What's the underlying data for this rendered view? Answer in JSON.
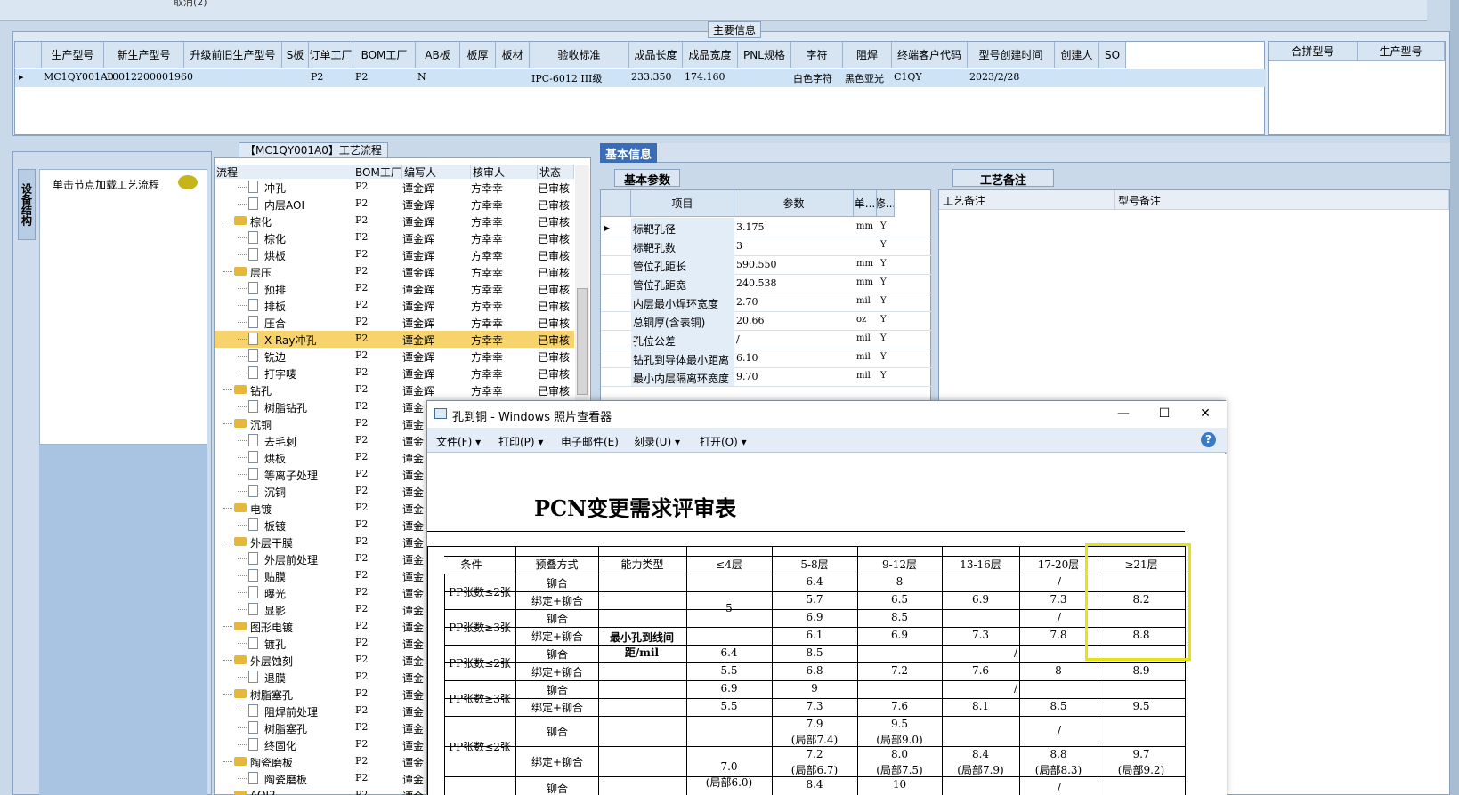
{
  "top": {
    "cut_text": "取消(2)"
  },
  "main_info": {
    "title": "主要信息",
    "headers": [
      "生产型号",
      "新生产型号",
      "升级前旧生产型号",
      "S板",
      "订单工厂",
      "BOM工厂",
      "AB板",
      "板厚",
      "板材",
      "验收标准",
      "成品长度",
      "成品宽度",
      "PNL规格",
      "字符",
      "阻焊",
      "终端客户代码",
      "型号创建时间",
      "创建人",
      "SO"
    ],
    "row": [
      "MC1QY001A0",
      "10012200001960",
      "",
      "",
      "P2",
      "P2",
      "N",
      "",
      "",
      "IPC-6012 III级",
      "233.350",
      "174.160",
      "",
      "白色字符",
      "黑色亚光",
      "C1QY",
      "2023/2/28",
      "",
      ""
    ],
    "side_headers": [
      "合拼型号",
      "生产型号"
    ]
  },
  "left": {
    "vertical_tab": "设备结构",
    "hint": "单击节点加载工艺流程"
  },
  "flow": {
    "title": "【MC1QY001A0】工艺流程",
    "headers": [
      "流程",
      "BOM工厂",
      "编写人",
      "核审人",
      "状态"
    ],
    "rows": [
      {
        "name": "冲孔",
        "level": 2,
        "bom": "P2",
        "writer": "谭金辉",
        "reviewer": "方幸幸",
        "status": "已审核"
      },
      {
        "name": "内层AOI",
        "level": 2,
        "bom": "P2",
        "writer": "谭金辉",
        "reviewer": "方幸幸",
        "status": "已审核"
      },
      {
        "name": "棕化",
        "level": 1,
        "bom": "P2",
        "writer": "谭金辉",
        "reviewer": "方幸幸",
        "status": "已审核"
      },
      {
        "name": "棕化",
        "level": 2,
        "bom": "P2",
        "writer": "谭金辉",
        "reviewer": "方幸幸",
        "status": "已审核"
      },
      {
        "name": "烘板",
        "level": 2,
        "bom": "P2",
        "writer": "谭金辉",
        "reviewer": "方幸幸",
        "status": "已审核"
      },
      {
        "name": "层压",
        "level": 1,
        "bom": "P2",
        "writer": "谭金辉",
        "reviewer": "方幸幸",
        "status": "已审核"
      },
      {
        "name": "预排",
        "level": 2,
        "bom": "P2",
        "writer": "谭金辉",
        "reviewer": "方幸幸",
        "status": "已审核"
      },
      {
        "name": "排板",
        "level": 2,
        "bom": "P2",
        "writer": "谭金辉",
        "reviewer": "方幸幸",
        "status": "已审核"
      },
      {
        "name": "压合",
        "level": 2,
        "bom": "P2",
        "writer": "谭金辉",
        "reviewer": "方幸幸",
        "status": "已审核"
      },
      {
        "name": "X-Ray冲孔",
        "level": 2,
        "bom": "P2",
        "writer": "谭金辉",
        "reviewer": "方幸幸",
        "status": "已审核",
        "selected": true
      },
      {
        "name": "铣边",
        "level": 2,
        "bom": "P2",
        "writer": "谭金辉",
        "reviewer": "方幸幸",
        "status": "已审核"
      },
      {
        "name": "打字唛",
        "level": 2,
        "bom": "P2",
        "writer": "谭金辉",
        "reviewer": "方幸幸",
        "status": "已审核"
      },
      {
        "name": "钻孔",
        "level": 1,
        "bom": "P2",
        "writer": "谭金辉",
        "reviewer": "方幸幸",
        "status": "已审核"
      },
      {
        "name": "树脂钻孔",
        "level": 2,
        "bom": "P2",
        "writer": "谭金",
        "reviewer": "",
        "status": ""
      },
      {
        "name": "沉铜",
        "level": 1,
        "bom": "P2",
        "writer": "谭金",
        "reviewer": "",
        "status": ""
      },
      {
        "name": "去毛刺",
        "level": 2,
        "bom": "P2",
        "writer": "谭金",
        "reviewer": "",
        "status": ""
      },
      {
        "name": "烘板",
        "level": 2,
        "bom": "P2",
        "writer": "谭金",
        "reviewer": "",
        "status": ""
      },
      {
        "name": "等离子处理",
        "level": 2,
        "bom": "P2",
        "writer": "谭金",
        "reviewer": "",
        "status": ""
      },
      {
        "name": "沉铜",
        "level": 2,
        "bom": "P2",
        "writer": "谭金",
        "reviewer": "",
        "status": ""
      },
      {
        "name": "电镀",
        "level": 1,
        "bom": "P2",
        "writer": "谭金",
        "reviewer": "",
        "status": ""
      },
      {
        "name": "板镀",
        "level": 2,
        "bom": "P2",
        "writer": "谭金",
        "reviewer": "",
        "status": ""
      },
      {
        "name": "外层干膜",
        "level": 1,
        "bom": "P2",
        "writer": "谭金",
        "reviewer": "",
        "status": ""
      },
      {
        "name": "外层前处理",
        "level": 2,
        "bom": "P2",
        "writer": "谭金",
        "reviewer": "",
        "status": ""
      },
      {
        "name": "贴膜",
        "level": 2,
        "bom": "P2",
        "writer": "谭金",
        "reviewer": "",
        "status": ""
      },
      {
        "name": "曝光",
        "level": 2,
        "bom": "P2",
        "writer": "谭金",
        "reviewer": "",
        "status": ""
      },
      {
        "name": "显影",
        "level": 2,
        "bom": "P2",
        "writer": "谭金",
        "reviewer": "",
        "status": ""
      },
      {
        "name": "图形电镀",
        "level": 1,
        "bom": "P2",
        "writer": "谭金",
        "reviewer": "",
        "status": ""
      },
      {
        "name": "镀孔",
        "level": 2,
        "bom": "P2",
        "writer": "谭金",
        "reviewer": "",
        "status": ""
      },
      {
        "name": "外层蚀刻",
        "level": 1,
        "bom": "P2",
        "writer": "谭金",
        "reviewer": "",
        "status": ""
      },
      {
        "name": "退膜",
        "level": 2,
        "bom": "P2",
        "writer": "谭金",
        "reviewer": "",
        "status": ""
      },
      {
        "name": "树脂塞孔",
        "level": 1,
        "bom": "P2",
        "writer": "谭金",
        "reviewer": "",
        "status": ""
      },
      {
        "name": "阻焊前处理",
        "level": 2,
        "bom": "P2",
        "writer": "谭金",
        "reviewer": "",
        "status": ""
      },
      {
        "name": "树脂塞孔",
        "level": 2,
        "bom": "P2",
        "writer": "谭金",
        "reviewer": "",
        "status": ""
      },
      {
        "name": "终固化",
        "level": 2,
        "bom": "P2",
        "writer": "谭金",
        "reviewer": "",
        "status": ""
      },
      {
        "name": "陶瓷磨板",
        "level": 1,
        "bom": "P2",
        "writer": "谭金",
        "reviewer": "",
        "status": ""
      },
      {
        "name": "陶瓷磨板",
        "level": 2,
        "bom": "P2",
        "writer": "谭金",
        "reviewer": "",
        "status": ""
      },
      {
        "name": "AOI2",
        "level": 1,
        "bom": "P2",
        "writer": "谭金",
        "reviewer": "",
        "status": ""
      }
    ]
  },
  "basic": {
    "tab": "基本信息",
    "subtab": "基本参数",
    "headers": [
      "项目",
      "参数",
      "单...",
      "修..."
    ],
    "rows": [
      {
        "item": "标靶孔径",
        "param": "3.175",
        "unit": "mm",
        "mod": "Y"
      },
      {
        "item": "标靶孔数",
        "param": "3",
        "unit": "",
        "mod": "Y"
      },
      {
        "item": "管位孔距长",
        "param": "590.550",
        "unit": "mm",
        "mod": "Y"
      },
      {
        "item": "管位孔距宽",
        "param": "240.538",
        "unit": "mm",
        "mod": "Y"
      },
      {
        "item": "内层最小焊环宽度",
        "param": "2.70",
        "unit": "mil",
        "mod": "Y"
      },
      {
        "item": "总铜厚(含表铜)",
        "param": "20.66",
        "unit": "oz",
        "mod": "Y"
      },
      {
        "item": "孔位公差",
        "param": "/",
        "unit": "mil",
        "mod": "Y"
      },
      {
        "item": "钻孔到导体最小距离",
        "param": "6.10",
        "unit": "mil",
        "mod": "Y"
      },
      {
        "item": "最小内层隔离环宽度",
        "param": "9.70",
        "unit": "mil",
        "mod": "Y"
      }
    ]
  },
  "notes": {
    "tab": "工艺备注",
    "headers": [
      "工艺备注",
      "型号备注"
    ]
  },
  "viewer": {
    "title": "孔到铜 - Windows 照片查看器",
    "menu": [
      "文件(F)",
      "打印(P)",
      "电子邮件(E)",
      "刻录(U)",
      "打开(O)"
    ],
    "help": "?",
    "doc": {
      "title": "PCN变更需求评审表",
      "headers": [
        "条件",
        "预叠方式",
        "能力类型",
        "≤4层",
        "5-8层",
        "9-12层",
        "13-16层",
        "17-20层",
        "≥21层"
      ],
      "ability": "最小孔到线间距/mil",
      "cells": {
        "g1": "PP张数≤2张",
        "g2": "PP张数≥3张",
        "g3": "PP张数≤2张",
        "g4": "PP张数≥3张",
        "g5": "PP张数≤2张",
        "m1": "铆合",
        "b1": "绑定+铆合",
        "m2": "铆合",
        "b2": "绑定+铆合",
        "m3": "铆合",
        "b3": "绑定+铆合",
        "m4": "铆合",
        "b4": "绑定+铆合",
        "m5": "铆合",
        "b5": "绑定+铆合",
        "m6": "铆合",
        "five": "5",
        "r1c5": "6.4",
        "r1c6": "8",
        "r1s": "/",
        "r2c5": "5.7",
        "r2c6": "6.5",
        "r2c7": "6.9",
        "r2c8": "7.3",
        "r2c9": "8.2",
        "r3c5": "6.9",
        "r3c6": "8.5",
        "r3s": "/",
        "r4c5": "6.1",
        "r4c6": "6.9",
        "r4c7": "7.3",
        "r4c8": "7.8",
        "r4c9": "8.8",
        "r5c4": "6.4",
        "r5c5": "8.5",
        "r5s": "/",
        "r6c4": "5.5",
        "r6c5": "6.8",
        "r6c6": "7.2",
        "r6c7": "7.6",
        "r6c8": "8",
        "r6c9": "8.9",
        "r7c4": "6.9",
        "r7c5": "9",
        "r7s": "/",
        "r8c4": "5.5",
        "r8c5": "7.3",
        "r8c6": "7.6",
        "r8c7": "8.1",
        "r8c8": "8.5",
        "r8c9": "9.5",
        "r9c5a": "7.9",
        "r9c5b": "(局部7.4)",
        "r9c6a": "9.5",
        "r9c6b": "(局部9.0)",
        "r9s": "/",
        "r10c5a": "7.2",
        "r10c5b": "(局部6.7)",
        "r10c6a": "8.0",
        "r10c6b": "(局部7.5)",
        "r10c7a": "8.4",
        "r10c7b": "(局部7.9)",
        "r10c8a": "8.8",
        "r10c8b": "(局部8.3)",
        "r10c9a": "9.7",
        "r10c9b": "(局部9.2)",
        "r10c4a": "7.0",
        "r10c4b": "(局部6.0)",
        "r11c5": "8.4",
        "r11c6": "10",
        "r11s": "/"
      }
    }
  }
}
